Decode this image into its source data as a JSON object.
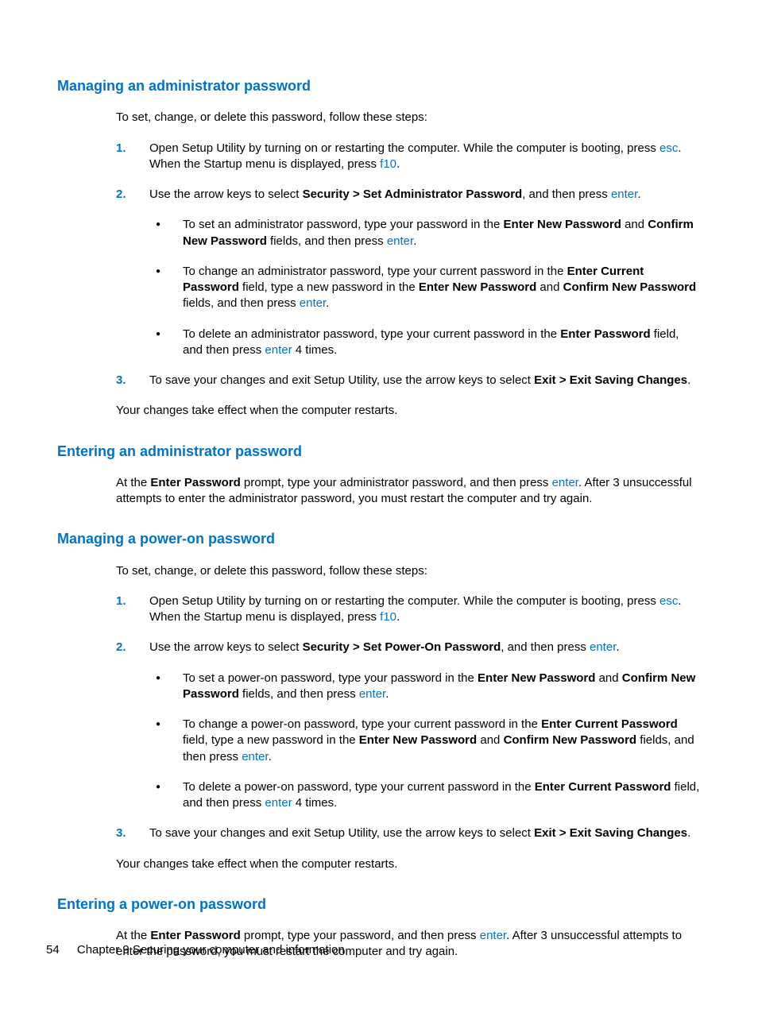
{
  "footer": {
    "page_number": "54",
    "chapter_label": "Chapter 9   Securing your computer and information"
  },
  "keys": {
    "esc": "esc",
    "f10": "f10",
    "enter": "enter"
  },
  "labels": {
    "security_set_admin": "Security > Set Administrator Password",
    "security_set_poweron": "Security > Set Power-On Password",
    "enter_new_password": "Enter New Password",
    "confirm_new_password": "Confirm New Password",
    "enter_current_password": "Enter Current Password",
    "confirm_new_password2": "Confirm New Password",
    "enter_password": "Enter Password",
    "exit_saving_changes": "Exit > Exit Saving Changes"
  },
  "s1": {
    "heading": "Managing an administrator password",
    "intro": "To set, change, or delete this password, follow these steps:",
    "step1_a": "Open Setup Utility by turning on or restarting the computer. While the computer is booting, press ",
    "step1_b": ". When the Startup menu is displayed, press ",
    "step1_c": ".",
    "step2_a": "Use the arrow keys to select ",
    "step2_b": ", and then press ",
    "step2_c": ".",
    "b1_a": "To set an administrator password, type your password in the ",
    "b1_b": " and ",
    "b1_c": " fields, and then press ",
    "b1_d": ".",
    "b2_a": "To change an administrator password, type your current password in the ",
    "b2_b": " field, type a new password in the ",
    "b2_c": " and ",
    "b2_d": " fields, and then press ",
    "b2_e": ".",
    "b3_a": "To delete an administrator password, type your current password in the ",
    "b3_b": " field, and then press ",
    "b3_c": " 4 times.",
    "step3_a": "To save your changes and exit Setup Utility, use the arrow keys to select ",
    "step3_b": ".",
    "outro": "Your changes take effect when the computer restarts."
  },
  "s2": {
    "heading": "Entering an administrator password",
    "a": "At the ",
    "b": " prompt, type your administrator password, and then press ",
    "c": ". After 3 unsuccessful attempts to enter the administrator password, you must restart the computer and try again."
  },
  "s3": {
    "heading": "Managing a power-on password",
    "intro": "To set, change, or delete this password, follow these steps:",
    "step1_a": "Open Setup Utility by turning on or restarting the computer. While the computer is booting, press ",
    "step1_b": ". When the Startup menu is displayed, press ",
    "step1_c": ".",
    "step2_a": "Use the arrow keys to select ",
    "step2_b": ", and then press ",
    "step2_c": ".",
    "b1_a": "To set a power-on password, type your password in the ",
    "b1_b": " and ",
    "b1_c": " fields, and then press ",
    "b1_d": ".",
    "b2_a": "To change a power-on password, type your current password in the ",
    "b2_b": " field, type a new password in the ",
    "b2_c": " and ",
    "b2_d": " fields, and then press ",
    "b2_e": ".",
    "b3_a": "To delete a power-on password, type your current password in the ",
    "b3_b": " field, and then press ",
    "b3_c": " 4 times.",
    "step3_a": "To save your changes and exit Setup Utility, use the arrow keys to select ",
    "step3_b": ".",
    "outro": "Your changes take effect when the computer restarts."
  },
  "s4": {
    "heading": "Entering a power-on password",
    "a": "At the ",
    "b": " prompt, type your password, and then press ",
    "c": ". After 3 unsuccessful attempts to enter the password, you must restart the computer and try again."
  },
  "nums": {
    "1": "1.",
    "2": "2.",
    "3": "3."
  }
}
